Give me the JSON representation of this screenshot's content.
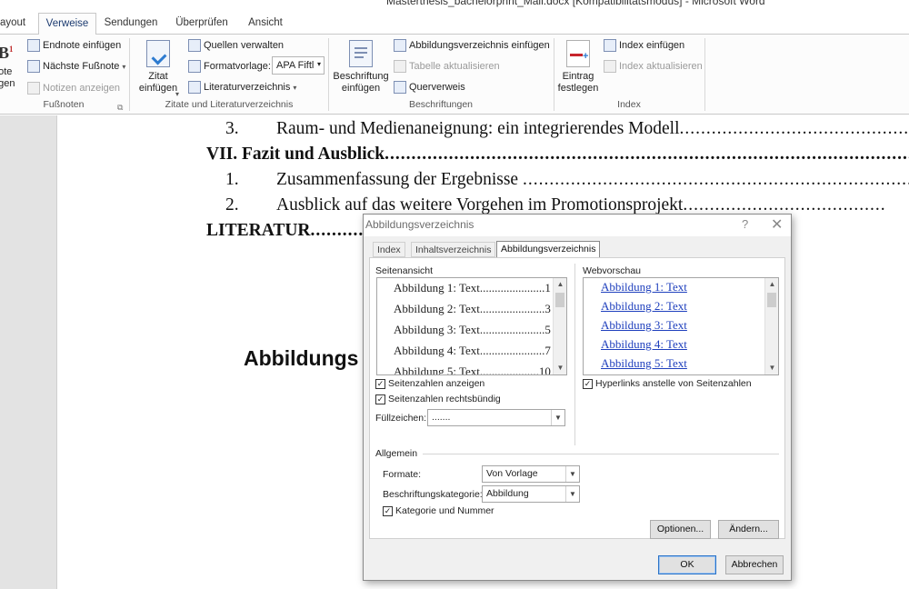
{
  "window": {
    "title": "Masterthesis_bachelorprint_Mail.docx [Kompatibilitätsmodus]  -  Microsoft Word"
  },
  "tabs": [
    "ayout",
    "Verweise",
    "Sendungen",
    "Überprüfen",
    "Ansicht"
  ],
  "ribbon": {
    "footnotes": {
      "big_label_1": "note",
      "big_label_2": "ügen",
      "endnote": "Endnote einfügen",
      "next_footnote": "Nächste Fußnote",
      "show_notes": "Notizen anzeigen",
      "group_label": "Fußnoten"
    },
    "citations": {
      "insert_citation_1": "Zitat",
      "insert_citation_2": "einfügen",
      "manage_sources": "Quellen verwalten",
      "style_label": "Formatvorlage:",
      "style_value": "APA Fiftl",
      "bibliography": "Literaturverzeichnis",
      "group_label": "Zitate und Literaturverzeichnis"
    },
    "captions": {
      "insert_caption_1": "Beschriftung",
      "insert_caption_2": "einfügen",
      "insert_tof": "Abbildungsverzeichnis einfügen",
      "update_table": "Tabelle aktualisieren",
      "cross_reference": "Querverweis",
      "group_label": "Beschriftungen"
    },
    "index": {
      "mark_entry_1": "Eintrag",
      "mark_entry_2": "festlegen",
      "insert_index": "Index einfügen",
      "update_index": "Index aktualisieren",
      "group_label": "Index"
    }
  },
  "document": {
    "lines": [
      {
        "num": "3.",
        "text": "Raum- und Medienaneignung: ein integrierendes Modell",
        "leader": "....................................................."
      },
      {
        "num": "",
        "text": "VII. Fazit und Ausblick",
        "leader": ".................................................................................................................."
      },
      {
        "num": "1.",
        "text": "Zusammenfassung der Ergebnisse ",
        "leader": "......................................................................................"
      },
      {
        "num": "2.",
        "text": "Ausblick auf das weitere Vorgehen im Promotionsprojekt",
        "leader": "......................................"
      },
      {
        "num": "",
        "text": "LITERATUR",
        "leader": "..........."
      }
    ],
    "heading": "Abbildungs"
  },
  "dialog": {
    "title": "Abbildungsverzeichnis",
    "help": "?",
    "close": "✕",
    "tabs": [
      "Index",
      "Inhaltsverzeichnis",
      "Abbildungsverzeichnis"
    ],
    "print_preview_label": "Seitenansicht",
    "print_preview": [
      {
        "text": "Abbildung 1: Text",
        "dots": "......................",
        "page": "1"
      },
      {
        "text": "Abbildung 2: Text",
        "dots": "......................",
        "page": "3"
      },
      {
        "text": "Abbildung 3: Text",
        "dots": "......................",
        "page": "5"
      },
      {
        "text": "Abbildung 4: Text",
        "dots": "......................",
        "page": "7"
      },
      {
        "text": "Abbildung 5: Text",
        "dots": "....................",
        "page": "10"
      }
    ],
    "web_preview_label": "Webvorschau",
    "web_preview": [
      "Abbildung 1: Text",
      "Abbildung 2: Text",
      "Abbildung 3: Text",
      "Abbildung 4: Text",
      "Abbildung 5: Text"
    ],
    "show_page_numbers": "Seitenzahlen anzeigen",
    "right_align_page_numbers": "Seitenzahlen rechtsbündig",
    "tab_leader_label": "Füllzeichen:",
    "tab_leader_value": ".......",
    "use_hyperlinks": "Hyperlinks anstelle von Seitenzahlen",
    "general_label": "Allgemein",
    "formats_label": "Formate:",
    "formats_value": "Von Vorlage",
    "caption_label_label": "Beschriftungskategorie:",
    "caption_label_value": "Abbildung",
    "include_label_number": "Kategorie und Nummer",
    "options_button": "Optionen...",
    "modify_button": "Ändern...",
    "ok_button": "OK",
    "cancel_button": "Abbrechen",
    "checked_mark": "✓"
  },
  "colors": {
    "link": "#1e3fbd",
    "active_tab_text": "#1c3b70",
    "default_button_border": "#2b73c7"
  }
}
